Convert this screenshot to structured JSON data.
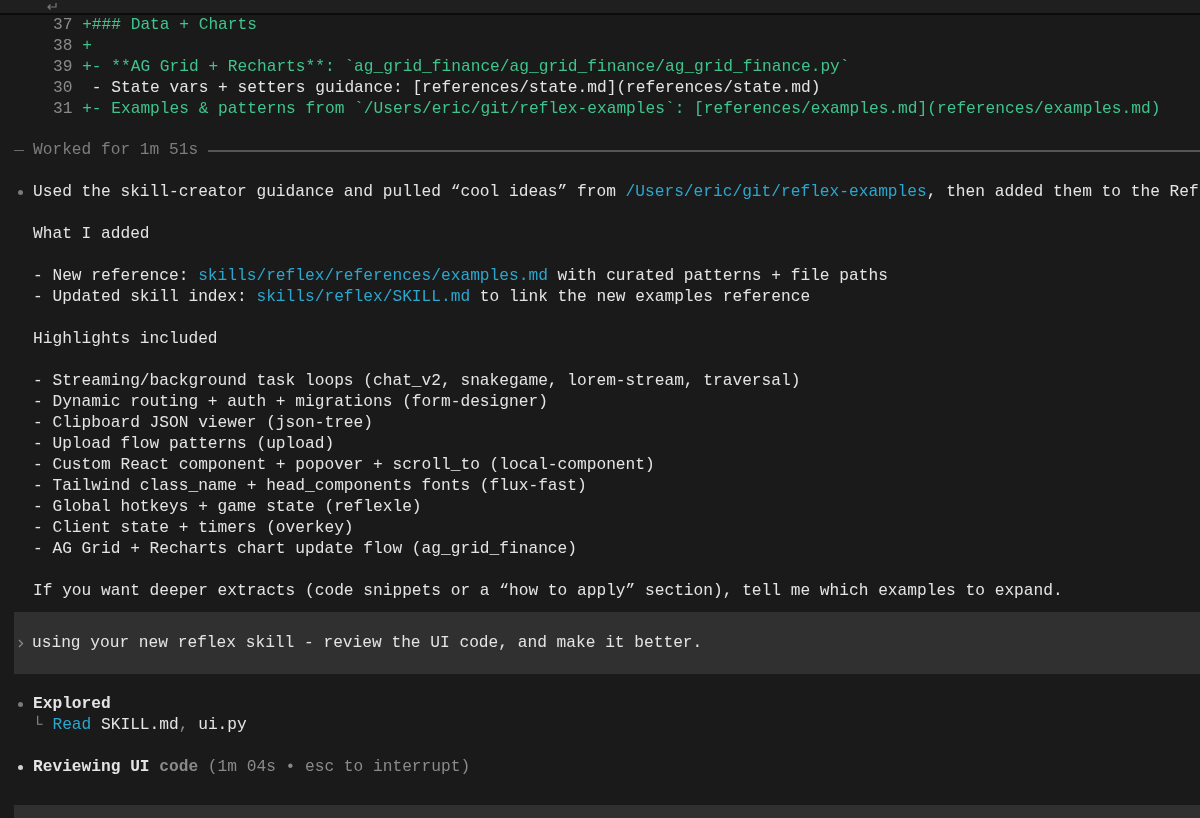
{
  "diff": [
    {
      "number": "37",
      "kind": "added",
      "text": "+### Data + Charts"
    },
    {
      "number": "38",
      "kind": "added",
      "text": "+"
    },
    {
      "number": "39",
      "kind": "added",
      "text": "+- **AG Grid + Recharts**: `ag_grid_finance/ag_grid_finance/ag_grid_finance.py`"
    },
    {
      "number": "30",
      "kind": "context",
      "text": " - State vars + setters guidance: [references/state.md](references/state.md)"
    },
    {
      "number": "31",
      "kind": "added",
      "text": "+- Examples & patterns from `/Users/eric/git/reflex-examples`: [references/examples.md](references/examples.md)"
    }
  ],
  "worked_divider": "Worked for 1m 51s",
  "response": {
    "blocks": [
      {
        "lines": [
          [
            {
              "kind": "plain",
              "text": "Used the skill-creator guidance and pulled “cool ideas” from "
            },
            {
              "kind": "path",
              "text": "/Users/eric/git/reflex-examples"
            },
            {
              "kind": "plain",
              "text": ", then added them to the Ref"
            }
          ]
        ]
      },
      {
        "lines": [
          [
            {
              "kind": "plain",
              "text": "What I added"
            }
          ]
        ]
      },
      {
        "lines": [
          [
            {
              "kind": "plain",
              "text": "- New reference: "
            },
            {
              "kind": "path",
              "text": "skills/reflex/references/examples.md"
            },
            {
              "kind": "plain",
              "text": " with curated patterns + file paths"
            }
          ],
          [
            {
              "kind": "plain",
              "text": "- Updated skill index: "
            },
            {
              "kind": "path",
              "text": "skills/reflex/SKILL.md"
            },
            {
              "kind": "plain",
              "text": " to link the new examples reference"
            }
          ]
        ]
      },
      {
        "lines": [
          [
            {
              "kind": "plain",
              "text": "Highlights included"
            }
          ]
        ]
      },
      {
        "lines": [
          [
            {
              "kind": "plain",
              "text": "- Streaming/background task loops (chat_v2, snakegame, lorem-stream, traversal)"
            }
          ],
          [
            {
              "kind": "plain",
              "text": "- Dynamic routing + auth + migrations (form-designer)"
            }
          ],
          [
            {
              "kind": "plain",
              "text": "- Clipboard JSON viewer (json-tree)"
            }
          ],
          [
            {
              "kind": "plain",
              "text": "- Upload flow patterns (upload)"
            }
          ],
          [
            {
              "kind": "plain",
              "text": "- Custom React component + popover + scroll_to (local-component)"
            }
          ],
          [
            {
              "kind": "plain",
              "text": "- Tailwind class_name + head_components fonts (flux-fast)"
            }
          ],
          [
            {
              "kind": "plain",
              "text": "- Global hotkeys + game state (reflexle)"
            }
          ],
          [
            {
              "kind": "plain",
              "text": "- Client state + timers (overkey)"
            }
          ],
          [
            {
              "kind": "plain",
              "text": "- AG Grid + Recharts chart update flow (ag_grid_finance)"
            }
          ]
        ]
      },
      {
        "lines": [
          [
            {
              "kind": "plain",
              "text": "If you want deeper extracts (code snippets or a “how to apply” section), tell me which examples to expand."
            }
          ]
        ]
      }
    ]
  },
  "prompt": {
    "text": "using your new reflex skill - review the UI code, and make it better."
  },
  "steps": [
    {
      "kind": "done",
      "title": "Explored",
      "branch": "└",
      "detail": [
        {
          "kind": "verb",
          "text": "Read"
        },
        {
          "kind": "plain",
          "text": " SKILL.md"
        },
        {
          "kind": "dim",
          "text": ","
        },
        {
          "kind": "plain",
          "text": " ui.py"
        }
      ]
    },
    {
      "kind": "running",
      "title": "Reviewing UI",
      "title_dim": " code",
      "status": " (1m 04s • esc to interrupt)"
    }
  ]
}
